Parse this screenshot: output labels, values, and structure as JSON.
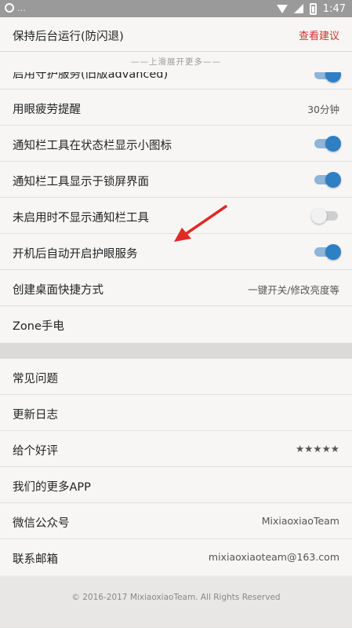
{
  "status_bar": {
    "title": "…",
    "time": "1:47"
  },
  "top_item": {
    "label": "保持后台运行(防闪退)",
    "action": "查看建议"
  },
  "hint": "——上滑展开更多——",
  "settings": [
    {
      "label": "启用守护服务(旧版advanced)",
      "toggle": true,
      "partial": true
    },
    {
      "label": "用眼疲劳提醒",
      "value": "30分钟"
    },
    {
      "label": "通知栏工具在状态栏显示小图标",
      "toggle": true
    },
    {
      "label": "通知栏工具显示于锁屏界面",
      "toggle": true
    },
    {
      "label": "未启用时不显示通知栏工具",
      "toggle": false
    },
    {
      "label": "开机后自动开启护眼服务",
      "toggle": true
    },
    {
      "label": "创建桌面快捷方式",
      "value": "一键开关/修改亮度等"
    },
    {
      "label": "Zone手电"
    }
  ],
  "about": [
    {
      "label": "常见问题"
    },
    {
      "label": "更新日志"
    },
    {
      "label": "给个好评",
      "value": "★★★★★"
    },
    {
      "label": "我们的更多APP"
    },
    {
      "label": "微信公众号",
      "value": "MixiaoxiaoTeam"
    },
    {
      "label": "联系邮箱",
      "value": "mixiaoxiaoteam@163.com"
    }
  ],
  "footer": "© 2016-2017 MixiaoxiaoTeam. All Rights Reserved",
  "colors": {
    "accent": "#2f7fc4",
    "link": "#d0312d",
    "arrow": "#e02a24"
  }
}
